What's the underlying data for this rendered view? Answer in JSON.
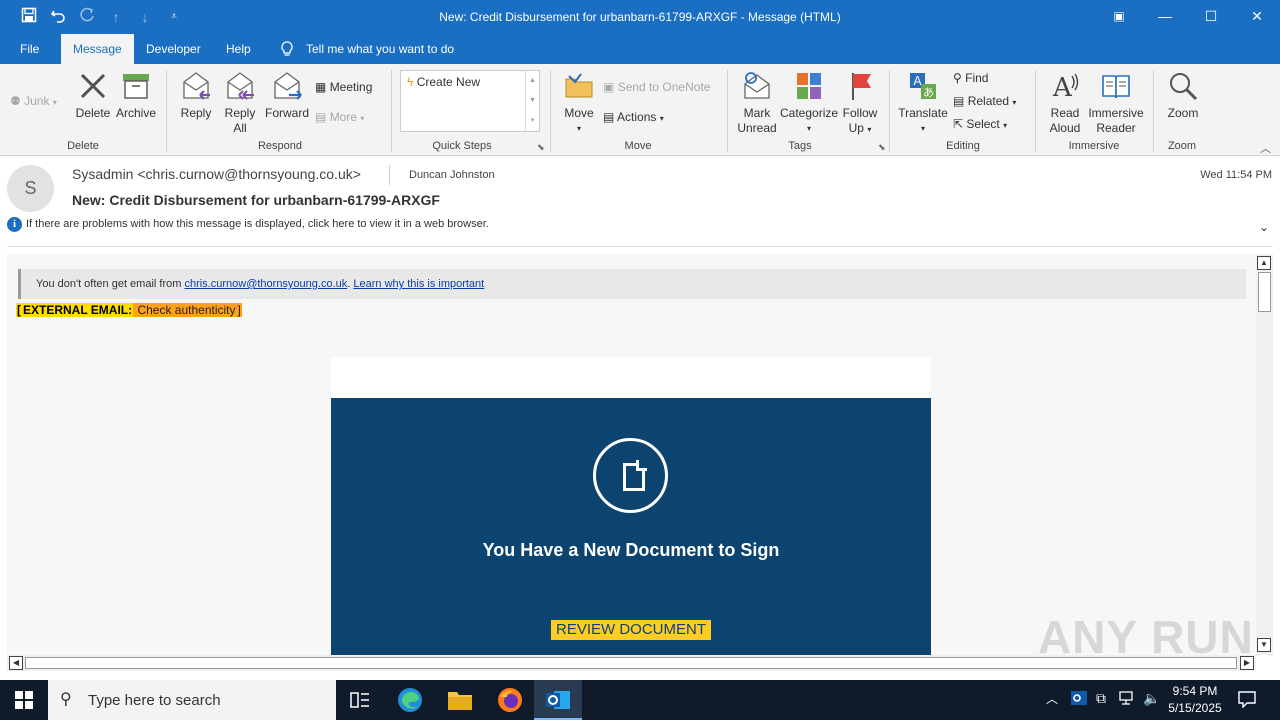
{
  "window": {
    "title": "New: Credit Disbursement for urbanbarn-61799-ARXGF  -  Message (HTML)",
    "quick_access": {
      "save_icon": "save-icon",
      "undo_icon": "undo-icon",
      "redo_icon": "redo-icon",
      "up_icon": "arrow-up-icon",
      "down_icon": "arrow-down-icon",
      "customize_icon": "customize-icon"
    },
    "controls": {
      "restore_ribbon": "▣",
      "minimize": "—",
      "maximize": "☐",
      "close": "✕"
    }
  },
  "menu": {
    "file": "File",
    "message": "Message",
    "developer": "Developer",
    "help": "Help",
    "tell_me": "Tell me what you want to do"
  },
  "ribbon": {
    "delete_group": {
      "junk": "Junk",
      "delete": "Delete",
      "archive": "Archive",
      "label": "Delete"
    },
    "respond_group": {
      "reply": "Reply",
      "reply_all_1": "Reply",
      "reply_all_2": "All",
      "forward": "Forward",
      "meeting": "Meeting",
      "more": "More",
      "label": "Respond"
    },
    "quick_steps": {
      "create_new": "Create New",
      "label": "Quick Steps"
    },
    "move_group": {
      "move": "Move",
      "send_onenote": "Send to OneNote",
      "actions": "Actions",
      "label": "Move"
    },
    "tags_group": {
      "mark_unread_1": "Mark",
      "mark_unread_2": "Unread",
      "categorize": "Categorize",
      "follow_up_1": "Follow",
      "follow_up_2": "Up",
      "label": "Tags"
    },
    "editing_group": {
      "translate": "Translate",
      "find": "Find",
      "related": "Related",
      "select": "Select",
      "label": "Editing"
    },
    "immersive_group": {
      "read_aloud_1": "Read",
      "read_aloud_2": "Aloud",
      "immersive_reader_1": "Immersive",
      "immersive_reader_2": "Reader",
      "label": "Immersive"
    },
    "zoom_group": {
      "zoom": "Zoom",
      "label": "Zoom"
    }
  },
  "message": {
    "avatar_initial": "S",
    "from": "Sysadmin <chris.curnow@thornsyoung.co.uk>",
    "to": "Duncan Johnston",
    "date": "Wed 11:54 PM",
    "subject": "New: Credit Disbursement for urbanbarn-61799-ARXGF",
    "info_bar": "If there are problems with how this message is displayed, click here to view it in a web browser."
  },
  "body": {
    "notice_prefix": "You don't often get email from ",
    "notice_email": "chris.curnow@thornsyoung.co.uk",
    "notice_dot": ". ",
    "notice_link": "Learn why this is important",
    "ext_open": "[",
    "ext_key": "EXTERNAL EMAIL:",
    "ext_value": " Check authenticity",
    "ext_close": "]",
    "card_title": "You Have a New Document to Sign",
    "review_button": "REVIEW DOCUMENT"
  },
  "taskbar": {
    "search_placeholder": "Type here to search",
    "time": "9:54 PM",
    "date": "5/15/2025"
  },
  "watermark": "ANY RUN",
  "colors": {
    "titlebar": "#1a6fc3",
    "card": "#0d446f",
    "button": "#ffcc22",
    "ext_key": "#ffdd00",
    "ext_value": "#ffa020"
  }
}
